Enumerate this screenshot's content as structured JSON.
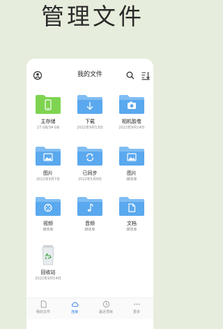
{
  "promo": {
    "title": "管理文件"
  },
  "topbar": {
    "title": "我的文件"
  },
  "colors": {
    "folder": "#5aa8ee",
    "folder_tab": "#7fbdf3",
    "storage_green": "#7ed451",
    "accent": "#2f7ee8"
  },
  "items": [
    {
      "name": "主存储",
      "sub": "27 GB/34 GB",
      "icon": "phone-icon"
    },
    {
      "name": "下载",
      "sub": "2022年9月13日",
      "icon": "download-icon"
    },
    {
      "name": "相机胶卷",
      "sub": "2022年9月14日",
      "icon": "camera-icon"
    },
    {
      "name": "图片",
      "sub": "2022年9月7日",
      "icon": "image-icon"
    },
    {
      "name": "已同步",
      "sub": "2022年5月8日",
      "icon": "sync-icon"
    },
    {
      "name": "图片",
      "sub": "媒体库",
      "icon": "image-icon"
    },
    {
      "name": "视频",
      "sub": "媒体库",
      "icon": "film-icon"
    },
    {
      "name": "音频",
      "sub": "媒体库",
      "icon": "music-icon"
    },
    {
      "name": "文档",
      "sub": "媒体库",
      "icon": "document-icon"
    },
    {
      "name": "回收站",
      "sub": "2022年9月14日",
      "icon": "recycle-bin-icon"
    }
  ],
  "bottom_nav": [
    {
      "label": "我的文件",
      "icon": "file-icon",
      "active": false
    },
    {
      "label": "连接",
      "icon": "cloud-icon",
      "active": true
    },
    {
      "label": "最近项目",
      "icon": "clock-icon",
      "active": false
    },
    {
      "label": "更多",
      "icon": "more-icon",
      "active": false
    }
  ]
}
